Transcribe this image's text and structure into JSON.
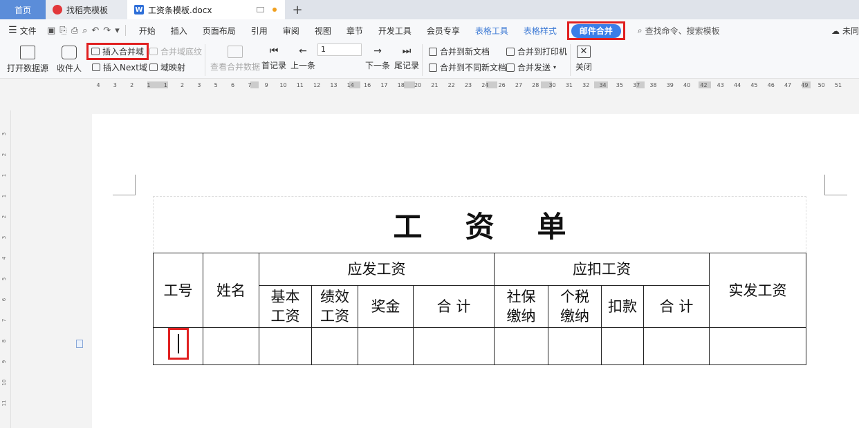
{
  "tabs": {
    "home": "首页",
    "docer": "找稻壳模板",
    "doc": "工资条模板.docx",
    "add": "+"
  },
  "menubar": {
    "file": "文件",
    "items": [
      "开始",
      "插入",
      "页面布局",
      "引用",
      "审阅",
      "视图",
      "章节",
      "开发工具",
      "会员专享"
    ],
    "table_tools": "表格工具",
    "table_style": "表格样式",
    "active": "邮件合并",
    "search_placeholder": "查找命令、搜索模板",
    "cloud": "未同"
  },
  "ribbon": {
    "open_source": "打开数据源",
    "recipient": "收件人",
    "insert_merge_field": "插入合并域",
    "insert_next": "插入Next域",
    "merge_field_shading": "合并域底纹",
    "field_mapping": "域映射",
    "view_merged": "查看合并数据",
    "first": "首记录",
    "prev": "上一条",
    "record_value": "1",
    "next": "下一条",
    "last": "尾记录",
    "to_new_doc": "合并到新文档",
    "to_diff_docs": "合并到不同新文档",
    "to_printer": "合并到打印机",
    "send": "合并发送",
    "close": "关闭"
  },
  "ruler": {
    "labels": [
      "4",
      "3",
      "2",
      "1",
      "1",
      "2",
      "3",
      "5",
      "6",
      "7",
      "9",
      "10",
      "11",
      "12",
      "13",
      "14",
      "16",
      "17",
      "18",
      "20",
      "21",
      "22",
      "23",
      "24",
      "26",
      "27",
      "28",
      "30",
      "31",
      "32",
      "34",
      "35",
      "37",
      "38",
      "39",
      "40",
      "42",
      "43",
      "44",
      "45",
      "46",
      "47",
      "49",
      "50",
      "51"
    ]
  },
  "vruler": {
    "labels": [
      "3",
      "2",
      "1",
      "1",
      "2",
      "3",
      "4",
      "5",
      "6",
      "7",
      "8",
      "9",
      "10",
      "11"
    ]
  },
  "document": {
    "title": "工资单",
    "headers": {
      "id": "工号",
      "name": "姓名",
      "payable": "应发工资",
      "deductions": "应扣工资",
      "net": "实发工资",
      "base": "基本工资",
      "performance": "绩效工资",
      "bonus": "奖金",
      "subtotal1": "合 计",
      "social": "社保缴纳",
      "tax": "个税缴纳",
      "withhold": "扣款",
      "subtotal2": "合 计"
    }
  },
  "colors": {
    "highlight": "#e02020",
    "active_tab": "#3a7ee8",
    "home_tab": "#5b8dd9"
  }
}
